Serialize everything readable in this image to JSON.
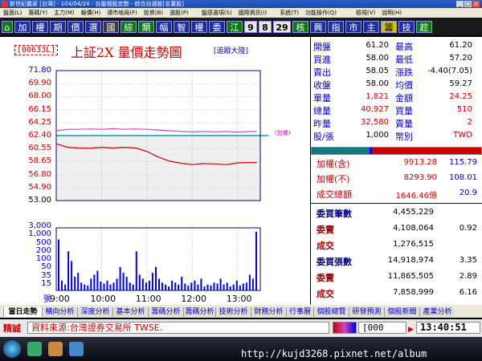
{
  "window": {
    "title": "新世紀贏家 [台灣] - 104/04/24 - 台盤個股走勢 - 綜合自選股[名董股]"
  },
  "menu": [
    "盤面(L)",
    "籌碼(Y)",
    "主力(M)",
    "報價(H)",
    "環市格局(F)",
    "投資(B)",
    "選股(P)",
    "",
    "盤感選項(S)",
    "國際資訊(I)",
    "",
    "系統(T)",
    "功能操作(Q)",
    "",
    "",
    "檢視(V)",
    "說明(H)"
  ],
  "toolbar": {
    "left_buttons": [
      "加",
      "權",
      "期",
      "價",
      "選",
      "國",
      "綜",
      "類",
      "幅",
      "智",
      "權",
      "委",
      "江"
    ],
    "num_buttons": [
      "9",
      "8",
      "29"
    ],
    "right_buttons": [
      "核",
      "興",
      "指",
      "市",
      "主",
      "籌",
      "技",
      "趁"
    ]
  },
  "chart_header": {
    "code": "[00633L]",
    "title": "上証2X 量價走勢圖",
    "tracking": "[追蹤大陸]"
  },
  "chart_data": [
    {
      "type": "line",
      "x": [
        "9:00",
        "9:15",
        "9:30",
        "9:45",
        "10:00",
        "10:15",
        "10:30",
        "10:45",
        "11:00",
        "11:15",
        "11:30",
        "11:45",
        "12:00",
        "12:15",
        "12:30",
        "12:45",
        "13:00",
        "13:15",
        "13:25"
      ],
      "xticks": [
        "9:00",
        "10:00",
        "11:00",
        "12:00",
        "13:00"
      ],
      "series": [
        {
          "name": "",
          "values": [
            61.2,
            60.7,
            60.6,
            60.55,
            60.7,
            60.6,
            60.7,
            60.6,
            60.1,
            59.3,
            58.7,
            58.4,
            58.2,
            58.35,
            58.3,
            58.2,
            58.45,
            58.5,
            58.5
          ]
        },
        {
          "name": "加權",
          "values": [
            63.1,
            63.3,
            63.3,
            63.35,
            63.3,
            63.4,
            63.3,
            63.35,
            63.3,
            63.2,
            63.1,
            63.0,
            62.95,
            63.0,
            62.95,
            63.0,
            62.9,
            63.0,
            63.0
          ]
        }
      ],
      "yticks": [
        "71.80",
        "69.90",
        "68.00",
        "66.15",
        "64.25",
        "62.40",
        "60.55",
        "58.65",
        "56.80",
        "54.90",
        "53.00"
      ],
      "ylim": [
        53.0,
        71.8
      ],
      "reference": 62.4
    },
    {
      "type": "bar",
      "yticks": [
        "3,000",
        "1,000",
        "500",
        "200",
        "100",
        "50",
        "35",
        "15"
      ],
      "ylabel": "張",
      "values": [
        260,
        50,
        30,
        200,
        150,
        70,
        90,
        40,
        30,
        25,
        60,
        80,
        100,
        45,
        35,
        50,
        30,
        40,
        60,
        120,
        90,
        70,
        40,
        30,
        200,
        80,
        60,
        40,
        50,
        90,
        120,
        60,
        40,
        30,
        20,
        50,
        40,
        30,
        70,
        35,
        25,
        40,
        50,
        30,
        60,
        20,
        30,
        25,
        40,
        35,
        60,
        30,
        40,
        20,
        30,
        50,
        25,
        35,
        40,
        80,
        60,
        300
      ]
    }
  ],
  "quote": [
    {
      "k1": "開盤",
      "v1": "61.20",
      "k2": "最高",
      "v2": "61.20"
    },
    {
      "k1": "買進",
      "v1": "58.00",
      "k2": "最低",
      "v2": "57.20"
    },
    {
      "k1": "賣出",
      "v1": "58.05",
      "k2": "漲跌",
      "v2": "-4.40(7.05)"
    },
    {
      "k1": "收盤",
      "v1": "58.00",
      "k2": "均價",
      "v2": "59.27"
    },
    {
      "k1": "單量",
      "v1": "1,821",
      "k2": "金額",
      "v2": "24.25"
    },
    {
      "k1": "總量",
      "v1": "40,927",
      "k2": "買量",
      "v2": "510"
    },
    {
      "k1": "昨量",
      "v1": "32,580",
      "k2": "賣量",
      "v2": "2"
    },
    {
      "k1": "股/張",
      "v1": "1,000",
      "k2": "幣別",
      "v2": "TWD"
    }
  ],
  "index_info": [
    {
      "label": "加權(含)",
      "v1": "9913.28",
      "v2": "115.79"
    },
    {
      "label": "加權(不)",
      "v1": "8293.90",
      "v2": "108.01"
    },
    {
      "label": "成交總額",
      "v1": "1646.46億",
      "v2": "20.9"
    }
  ],
  "market_stats": [
    {
      "label": "委買筆數",
      "v1": "4,455,229",
      "v2": ""
    },
    {
      "label": "委賣",
      "v1": "4,108,064",
      "v2": "0.92"
    },
    {
      "label": "成交",
      "v1": "1,276,515",
      "v2": ""
    },
    {
      "label": "委買張數",
      "v1": "14,918,974",
      "v2": "3.35"
    },
    {
      "label": "委賣",
      "v1": "11,865,505",
      "v2": "2.89"
    },
    {
      "label": "成交",
      "v1": "7,858,999",
      "v2": "6.16"
    }
  ],
  "tabs": [
    "當日走勢",
    "橫向分析",
    "深度分析",
    "基本分析",
    "籌碼分析",
    "籌碼分析",
    "技術分析",
    "財務分析",
    "行事曆",
    "個股總覽",
    "研發預測",
    "個股新聞",
    "產業分析"
  ],
  "status": {
    "tag": "精誠",
    "source": "資料來源:台灣證券交易所 TWSE.",
    "code": "[000",
    "time": "13:40:51"
  },
  "taskbar": {
    "url": "http://kujd3268.pixnet.net/album"
  },
  "colors": {
    "price": "#d00000",
    "weight": "#cc44cc",
    "volume": "#0000ee",
    "reference": "#00a0a0",
    "up": "#d00000",
    "down": "#008800",
    "label_blue": "#0000cc"
  }
}
